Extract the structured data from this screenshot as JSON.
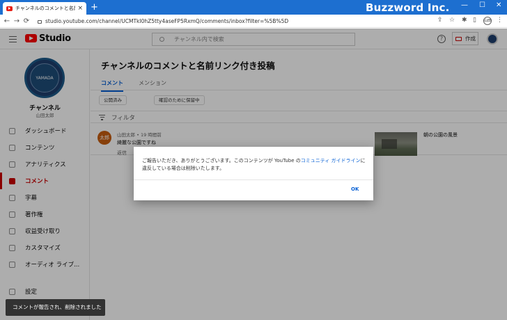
{
  "browser": {
    "tab_title": "チャンネルのコメントと名前リンク付き",
    "tab_close": "×",
    "new_tab": "+",
    "brand": "Buzzword Inc.",
    "url": "studio.youtube.com/channel/UCMTkI0hZ5tty4aseFP5RxmQ/comments/inbox?filter=%5B%5D",
    "profile_badge": "山田"
  },
  "header": {
    "app_name": "Studio",
    "search_placeholder": "チャンネル内で検索",
    "create_label": "作成",
    "help_label": "?"
  },
  "sidebar": {
    "avatar_text": "YAMADA",
    "channel_label": "チャンネル",
    "channel_name": "山田太郎",
    "items": [
      {
        "label": "ダッシュボード",
        "icon": "dashboard-icon"
      },
      {
        "label": "コンテンツ",
        "icon": "content-icon"
      },
      {
        "label": "アナリティクス",
        "icon": "analytics-icon"
      },
      {
        "label": "コメント",
        "icon": "comments-icon",
        "active": true
      },
      {
        "label": "字幕",
        "icon": "subtitles-icon"
      },
      {
        "label": "著作権",
        "icon": "copyright-icon"
      },
      {
        "label": "収益受け取り",
        "icon": "monetization-icon"
      },
      {
        "label": "カスタマイズ",
        "icon": "customization-icon"
      },
      {
        "label": "オーディオ ライブ...",
        "icon": "audio-library-icon"
      }
    ],
    "settings_label": "設定"
  },
  "main": {
    "title": "チャンネルのコメントと名前リンク付き投稿",
    "tabs": [
      "コメント",
      "メンション"
    ],
    "chips": [
      "公開済み",
      "確認のために保留中"
    ],
    "filter_label": "フィルタ",
    "comment": {
      "avatar_text": "太郎",
      "meta": "山田太郎 • 19 時間前",
      "text": "綺麗な公園ですね",
      "reply": "返信",
      "video_title": "朝の公園の風景"
    }
  },
  "dialog": {
    "message_before": "ご報告いただき、ありがとうございます。このコンテンツが YouTube の",
    "message_link": "コミュニティ ガイドライン",
    "message_after": "に違反している場合は削除いたします。",
    "ok_label": "OK"
  },
  "snackbar": {
    "text": "コメントが報告され、削除されました"
  },
  "colors": {
    "titlebar": "#1d6fd0",
    "accent": "#cc0000",
    "link": "#065fd4"
  }
}
